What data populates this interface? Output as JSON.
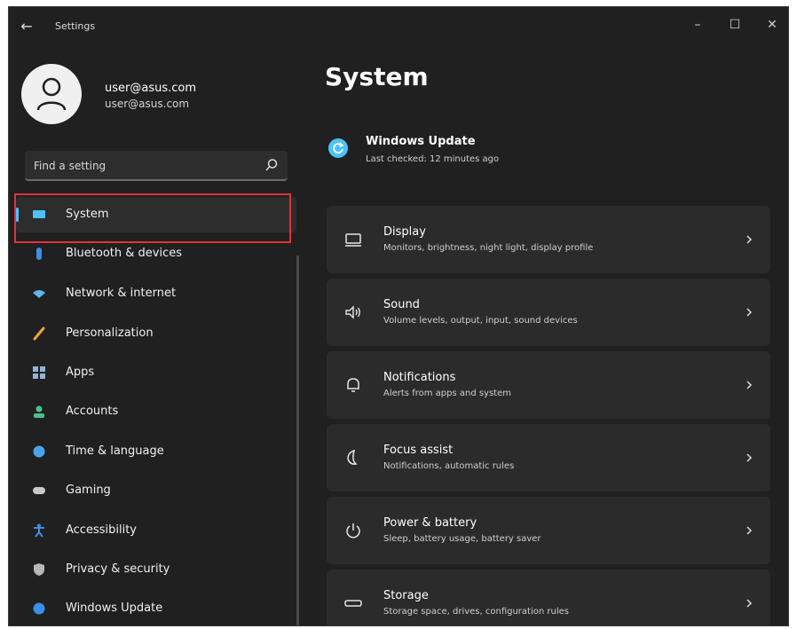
{
  "window": {
    "title": "Settings",
    "back_glyph": "←",
    "minimize_glyph": "–",
    "maximize_glyph": "☐",
    "close_glyph": "✕"
  },
  "profile": {
    "name": "user@asus.com",
    "email": "user@asus.com"
  },
  "search": {
    "placeholder": "Find a setting"
  },
  "sidebar": {
    "items": [
      {
        "label": "System",
        "icon": "monitor-icon",
        "active": true
      },
      {
        "label": "Bluetooth & devices",
        "icon": "bluetooth-icon"
      },
      {
        "label": "Network & internet",
        "icon": "wifi-icon"
      },
      {
        "label": "Personalization",
        "icon": "brush-icon"
      },
      {
        "label": "Apps",
        "icon": "apps-icon"
      },
      {
        "label": "Accounts",
        "icon": "person-icon"
      },
      {
        "label": "Time & language",
        "icon": "globe-clock-icon"
      },
      {
        "label": "Gaming",
        "icon": "gamepad-icon"
      },
      {
        "label": "Accessibility",
        "icon": "accessibility-icon"
      },
      {
        "label": "Privacy & security",
        "icon": "shield-icon"
      },
      {
        "label": "Windows Update",
        "icon": "update-icon"
      }
    ]
  },
  "main": {
    "title": "System",
    "windows_update": {
      "title": "Windows Update",
      "subtitle": "Last checked: 12 minutes ago"
    },
    "cards": [
      {
        "title": "Display",
        "subtitle": "Monitors, brightness, night light, display profile",
        "icon": "display-icon"
      },
      {
        "title": "Sound",
        "subtitle": "Volume levels, output, input, sound devices",
        "icon": "speaker-icon"
      },
      {
        "title": "Notifications",
        "subtitle": "Alerts from apps and system",
        "icon": "bell-icon"
      },
      {
        "title": "Focus assist",
        "subtitle": "Notifications, automatic rules",
        "icon": "moon-icon"
      },
      {
        "title": "Power & battery",
        "subtitle": "Sleep, battery usage, battery saver",
        "icon": "power-icon"
      },
      {
        "title": "Storage",
        "subtitle": "Storage space, drives, configuration rules",
        "icon": "storage-icon"
      }
    ]
  },
  "colors": {
    "accent": "#4cc2ff",
    "highlight": "#e0333a",
    "background": "#202020",
    "card": "#2b2b2b"
  }
}
